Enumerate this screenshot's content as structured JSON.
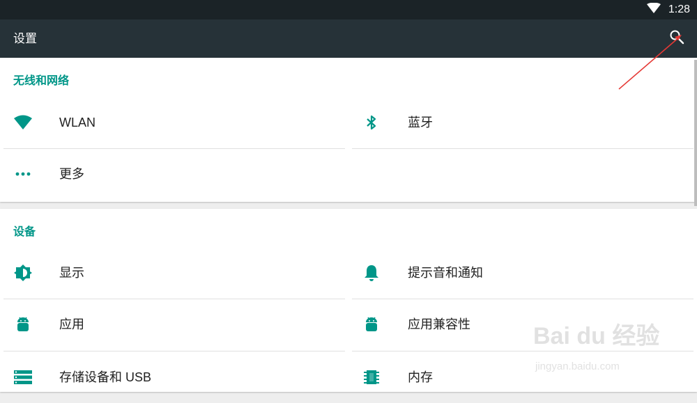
{
  "status_bar": {
    "time": "1:28",
    "icons": [
      "wifi-icon"
    ]
  },
  "app_bar": {
    "title": "设置",
    "search_icon": "search-icon"
  },
  "sections": [
    {
      "title": "无线和网络",
      "items": [
        {
          "label": "WLAN",
          "icon": "wifi-icon"
        },
        {
          "label": "蓝牙",
          "icon": "bluetooth-icon"
        },
        {
          "label": "更多",
          "icon": "more-dots-icon"
        }
      ]
    },
    {
      "title": "设备",
      "items": [
        {
          "label": "显示",
          "icon": "brightness-icon"
        },
        {
          "label": "提示音和通知",
          "icon": "bell-icon"
        },
        {
          "label": "应用",
          "icon": "android-icon"
        },
        {
          "label": "应用兼容性",
          "icon": "android-icon"
        },
        {
          "label": "存储设备和 USB",
          "icon": "storage-icon"
        },
        {
          "label": "内存",
          "icon": "memory-chip-icon"
        }
      ]
    }
  ],
  "watermark": {
    "brand": "Bai du 经验",
    "url": "jingyan.baidu.com"
  },
  "colors": {
    "accent": "#009688",
    "status_bar": "#1b2327",
    "app_bar": "#263238",
    "annotation_arrow": "#e53935"
  }
}
